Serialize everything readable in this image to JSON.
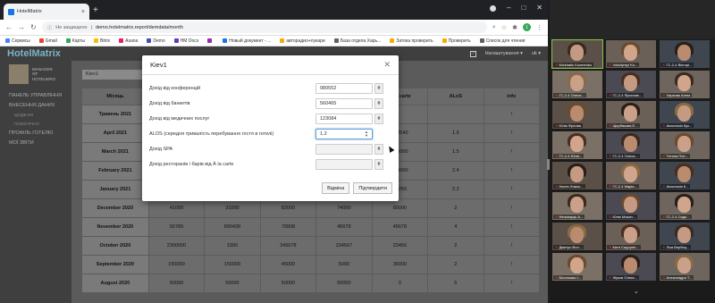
{
  "browser": {
    "tab_title": "HotelMatrix",
    "url_security": "Не защищено",
    "url": "demo.hotelmatrix.report/demdata/month",
    "profile_initial": "1",
    "bookmarks": [
      "Сервисы",
      "Gmail",
      "Карты",
      "Bitrix",
      "Asana",
      "Demo",
      "HM Docs",
      "",
      "Новый документ - ...",
      "авторадио+лукари",
      "База отдела Харь...",
      "Затока проверить",
      "Проверить",
      "Список для чтения"
    ],
    "bookmark_colors": [
      "#4285f4",
      "#ea4335",
      "#34a853",
      "#fbbc05",
      "#e91e63",
      "#3f51b5",
      "#673ab7",
      "#9c27b0",
      "#1a73e8",
      "#f9ab00",
      "#616161",
      "#f9ab00",
      "#f9ab00",
      "#616161"
    ]
  },
  "app": {
    "logo": "HotelMatrix",
    "settings_label": "Налаштування ▾",
    "lang": "uk ▾",
    "manager_label": "MANAGER\nOF\nHOTELIERO",
    "sidebar": [
      {
        "label": "ПАНЕЛЬ УПРАВЛІННЯ"
      },
      {
        "label": "ВНЕСЕННЯ ДАНИХ"
      },
      {
        "label": "ЩОДЕННІ",
        "sub": true
      },
      {
        "label": "ПОМІСЯЧНО",
        "sub": true
      },
      {
        "label": "ПРОФІЛЬ ГОТЕЛЮ"
      },
      {
        "label": "МОЇ ЗВІТИ"
      }
    ],
    "hotel_select": "Kiev1",
    "table": {
      "headers": [
        "Місяць",
        "",
        "",
        "",
        "",
        "À la carte",
        "ALoS",
        "info"
      ],
      "rows": [
        [
          "Травень 2021",
          "",
          "",
          "",
          "",
          "",
          "",
          "!"
        ],
        [
          "April 2021",
          "",
          "",
          "",
          "",
          "568540",
          "1.5",
          "!"
        ],
        [
          "March 2021",
          "",
          "",
          "",
          "",
          "160000",
          "1.5",
          "!"
        ],
        [
          "February 2021",
          "",
          "",
          "",
          "",
          "180000",
          "2.4",
          "!"
        ],
        [
          "January 2021",
          "",
          "",
          "",
          "",
          "79250",
          "2.2",
          "!"
        ],
        [
          "December 2020",
          "41000",
          "31000",
          "82000",
          "74000",
          "80000",
          "2",
          "!"
        ],
        [
          "November 2020",
          "56789",
          "890439",
          "78908",
          "45678",
          "45678",
          "4",
          "!"
        ],
        [
          "October 2020",
          "2300000",
          "1900",
          "345678",
          "234567",
          "23456",
          "2",
          "!"
        ],
        [
          "September 2020",
          "150000",
          "150000",
          "45000",
          "5000",
          "36000",
          "2",
          "!"
        ],
        [
          "August 2020",
          "50000",
          "50000",
          "50000",
          "50000",
          "0",
          "5",
          "!"
        ]
      ]
    }
  },
  "modal": {
    "title": "Kiev1",
    "fields": [
      {
        "label": "Дохід від конференцій",
        "value": "980552",
        "unit": "₴"
      },
      {
        "label": "Дохід від банкетів",
        "value": "560465",
        "unit": "₴"
      },
      {
        "label": "Дохід від медичних послуг",
        "value": "123084",
        "unit": "₴"
      },
      {
        "label": "ALOS (середня тривалість перебування гостя в готелі)",
        "value": "1.2",
        "unit": "",
        "active": true
      },
      {
        "label": "Дохід SPA",
        "value": "",
        "unit": "₴"
      },
      {
        "label": "Дохід ресторанів і барів від À la carte",
        "value": "",
        "unit": "₴"
      }
    ],
    "cancel_label": "Відміна",
    "confirm_label": "Підтвердити"
  },
  "video": {
    "participants": [
      "Mickhailo Kuzmenko",
      "Volodymyr Ko...",
      "ГС-2-4 Вікторі...",
      "ГС-2-4 Олеся...",
      "ГС-2-4 Ярослав...",
      "Харкова Аліна",
      "Юлія Фрлова",
      "Щербакова Е...",
      "Анастасія Кук...",
      "ГС-2-4 Юлія...",
      "ГС-2-4 Олеся...",
      "Тетяна Поп...",
      "Настя Ложко...",
      "ГС-2-4 Марія...",
      "Анастасія К...",
      "Нечипорук А...",
      "Юлія Мокан...",
      "ГС-2-4 Сидо...",
      "Дмитро Вол...",
      "Катя Сидорен...",
      "Ліза Вербиц...",
      "Білоножко І...",
      "Жуков Олекс...",
      "Александра Т..."
    ],
    "more_icon": "chevron-down-icon"
  }
}
